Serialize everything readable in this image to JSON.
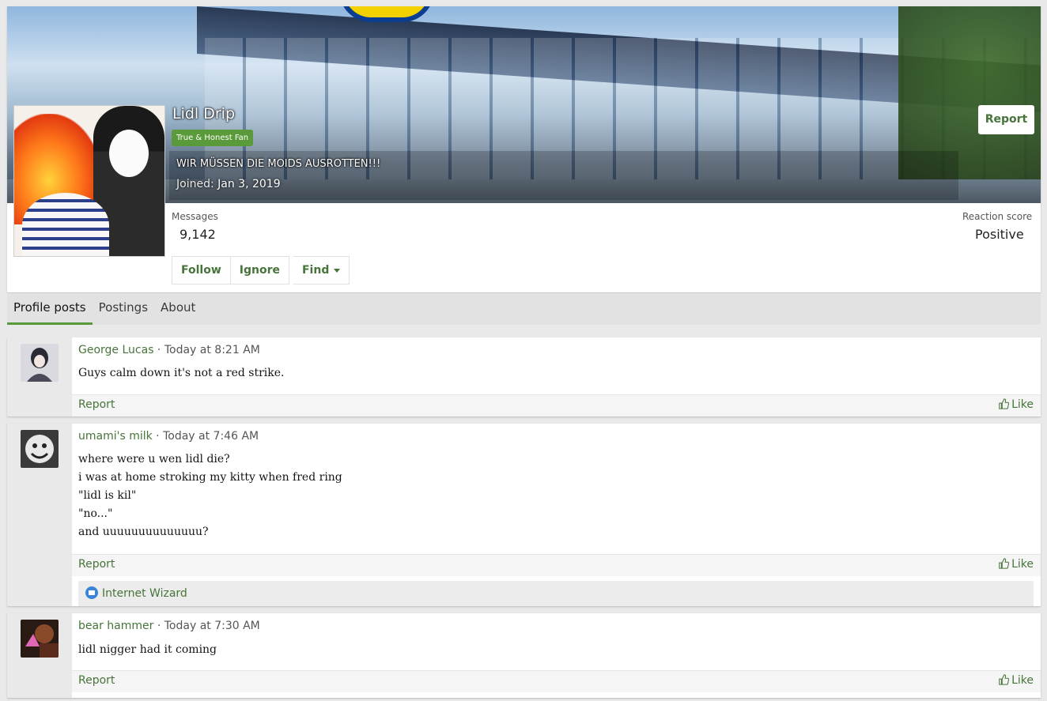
{
  "profile": {
    "username": "Lidl Drip",
    "user_title": "True & Honest Fan",
    "custom_title": "WIR MÜSSEN DIE MOIDS AUSROTTEN!!!",
    "joined_label": "Joined:",
    "joined_date": "Jan 3, 2019",
    "report_label": "Report",
    "stats": {
      "messages_label": "Messages",
      "messages_value": "9,142",
      "reaction_label": "Reaction score",
      "reaction_value": "Positive"
    },
    "buttons": {
      "follow": "Follow",
      "ignore": "Ignore",
      "find": "Find"
    }
  },
  "tabs": [
    {
      "label": "Profile posts",
      "active": true
    },
    {
      "label": "Postings",
      "active": false
    },
    {
      "label": "About",
      "active": false
    }
  ],
  "posts": [
    {
      "user": "George Lucas",
      "time": "Today at 8:21 AM",
      "lines": [
        "Guys calm down it's not a red strike."
      ],
      "report": "Report",
      "like": "Like"
    },
    {
      "user": "umami's milk",
      "time": "Today at 7:46 AM",
      "lines": [
        "where were u wen lidl die?",
        "i was at home stroking my kitty when fred ring",
        "\"lidl is kil\"",
        "\"no...\"",
        "and uuuuuuuuuuuuuu?"
      ],
      "report": "Report",
      "like": "Like",
      "reaction_user": "Internet Wizard"
    },
    {
      "user": "bear hammer",
      "time": "Today at 7:30 AM",
      "lines": [
        "lidl nigger had it coming"
      ],
      "report": "Report",
      "like": "Like"
    }
  ],
  "colors": {
    "accent": "#47743a",
    "badge": "#5a9a3a",
    "reaction": "#3b85d8"
  }
}
